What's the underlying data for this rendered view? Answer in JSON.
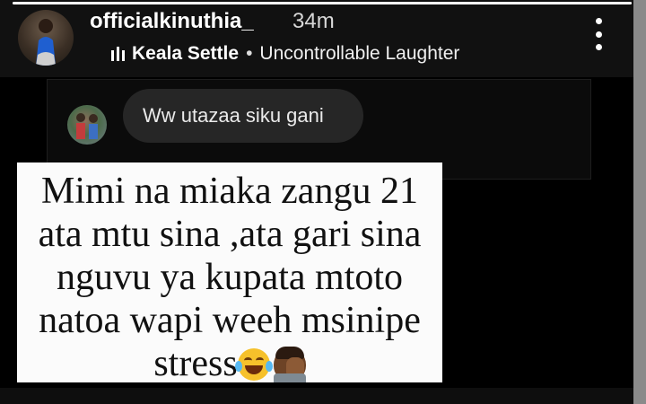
{
  "story": {
    "progress": 1.0,
    "header": {
      "username": "officialkinuthia_",
      "time_ago": "34m",
      "music": {
        "artist": "Keala Settle",
        "separator": "•",
        "song": "Uncontrollable Laughter"
      }
    },
    "reply": {
      "text": "Ww utazaa siku gani"
    },
    "quote": {
      "lines": [
        "Mimi na miaka zangu 21",
        "ata mtu sina ,ata gari sina",
        "nguvu ya kupata mtoto",
        "natoa wapi weeh msinipe",
        "stress"
      ],
      "emojis": [
        "face-with-tears-of-joy",
        "person-facepalming"
      ]
    }
  },
  "colors": {
    "background": "#000000",
    "card": "#fbfbfb",
    "bubble": "#262626",
    "text_light": "#ffffff"
  }
}
